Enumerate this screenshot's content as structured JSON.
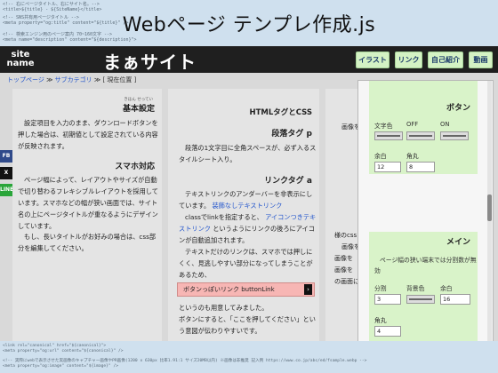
{
  "top_code": [
    "<!-- 右にページタイトル、右にサイト名。-->",
    "<title>${title} - ${SiteName}</title>",
    "<!-- SNS共有用ページタイトル -->",
    "<meta property=\"og:title\" content=\"${title}\" />",
    "<!-- 検索エンジン用のページ案内 70~160文字 -->",
    "<meta name=\"description\" content=\"${description}\">"
  ],
  "slide_title": "Webページ テンプレ作成.js",
  "header": {
    "logo_line1": "site",
    "logo_line2": "name",
    "site_title": "まぁサイト",
    "nav": [
      "イラスト",
      "リンク",
      "自己紹介",
      "動画"
    ]
  },
  "breadcrumb": {
    "top": "トップページ",
    "sep1": "≫",
    "sub": "サブカテゴリ",
    "sep2": "≫",
    "current": "[ 現在位置 ]"
  },
  "sns": [
    "FB",
    "X",
    "LINE"
  ],
  "col1": {
    "h1_ruby": "きほん せってい",
    "h1": "基本設定",
    "p1": "設定項目を入力のまま、ダウンロードボタンを押した場合は、初期値として設定されている内容が反映されます。",
    "h2": "スマホ対応",
    "p2": "ページ幅によって、レイアウトやサイズが自動で切り替わるフレキシブルレイアウトを採用しています。スマホなどの幅が狭い画面では、サイト名の上にページタイトルが重なるようにデザインしています。",
    "p3": "もし、長いタイトルがお好みの場合は、css部分を編集してください。"
  },
  "col2": {
    "title": "HTMLタグとCSS",
    "h_p": "段落タグ p",
    "p1": "段落の1文字目に全角スペースが、必ず入るスタイルシート入り。",
    "h_a": "リンクタグ a",
    "p2": "テキストリンクのアンダーバーを非表示にしています。",
    "link1": "装飾なしテキストリンク",
    "p3": "classでlinkを指定すると、",
    "link2": "アイコンつきテキストリンク",
    "p4": "というようにリンクの後ろにアイコンが自動追加されます。",
    "p5": "テキストだけのリンクは、スマホでは押しにくく、見逃しやすい部分になってしまうことがあるため、",
    "button_link": "ボタンっぽいリンク buttonLink",
    "p6": "というのも用意してみました。",
    "p7": "ボタンにすると、「ここを押してください」という意図が伝わりやすいです。"
  },
  "col3": {
    "t1": "画像を",
    "t2": "様のcss",
    "t3": "画像を",
    "t4": "画像を",
    "t5": "画像を",
    "t6": "の画面に"
  },
  "panel": {
    "button_heading": "ボタン",
    "text_color_label": "文字色",
    "off_label": "OFF",
    "on_label": "ON",
    "margin_label": "余白",
    "radius_label": "角丸",
    "margin_value": "12",
    "radius_value": "8",
    "main_heading": "メイン",
    "main_desc": "ページ幅の狭い端末では分割数が無効",
    "split_label": "分割",
    "bg_label": "背景色",
    "margin2_label": "余白",
    "split_value": "3",
    "margin2_value": "16",
    "radius2_label": "角丸",
    "radius2_value": "4"
  },
  "bottom_code": [
    "<link rel=\"canonical\" href=\"${canonical}\">",
    "<meta property=\"og:url\" content=\"${canonical}\" />",
    "<!-- 実際にwebで表示させた実画像のキャプチャー画像やPR画像(1200 x 630px 比率1.91:1 サイズ20MB以内) ※画像は非推奨 記入例 https://www.co.jp/abc/ed/fsample.webp -->",
    "<meta property=\"og:image\" content=\"${image}\" />"
  ],
  "colors": {
    "header_bg": "#1f1f1f",
    "nav_bg": "#d4f2c4",
    "link": "#2255cc",
    "button_link_bg": "#f7b6b4",
    "sns_fb": "#2f4a8a",
    "sns_x": "#111111",
    "sns_line": "#2aa53a"
  }
}
